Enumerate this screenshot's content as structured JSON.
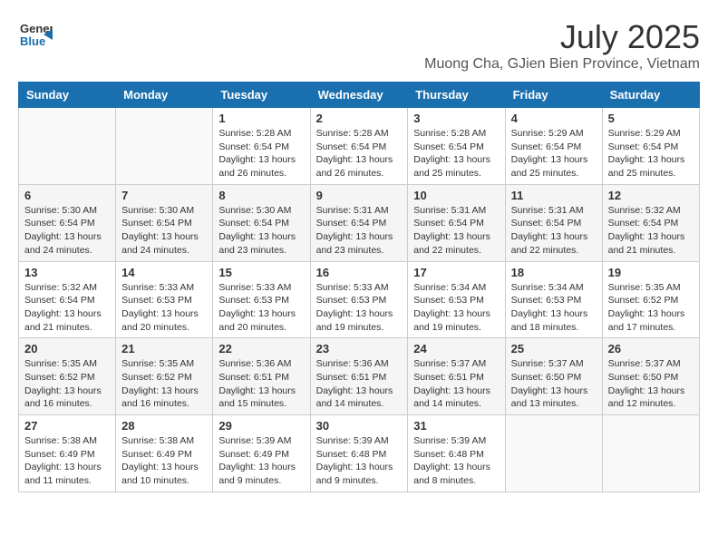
{
  "header": {
    "logo_general": "General",
    "logo_blue": "Blue",
    "month_year": "July 2025",
    "location": "Muong Cha, GJien Bien Province, Vietnam"
  },
  "days_of_week": [
    "Sunday",
    "Monday",
    "Tuesday",
    "Wednesday",
    "Thursday",
    "Friday",
    "Saturday"
  ],
  "weeks": [
    [
      {
        "day": "",
        "info": ""
      },
      {
        "day": "",
        "info": ""
      },
      {
        "day": "1",
        "info": "Sunrise: 5:28 AM\nSunset: 6:54 PM\nDaylight: 13 hours\nand 26 minutes."
      },
      {
        "day": "2",
        "info": "Sunrise: 5:28 AM\nSunset: 6:54 PM\nDaylight: 13 hours\nand 26 minutes."
      },
      {
        "day": "3",
        "info": "Sunrise: 5:28 AM\nSunset: 6:54 PM\nDaylight: 13 hours\nand 25 minutes."
      },
      {
        "day": "4",
        "info": "Sunrise: 5:29 AM\nSunset: 6:54 PM\nDaylight: 13 hours\nand 25 minutes."
      },
      {
        "day": "5",
        "info": "Sunrise: 5:29 AM\nSunset: 6:54 PM\nDaylight: 13 hours\nand 25 minutes."
      }
    ],
    [
      {
        "day": "6",
        "info": "Sunrise: 5:30 AM\nSunset: 6:54 PM\nDaylight: 13 hours\nand 24 minutes."
      },
      {
        "day": "7",
        "info": "Sunrise: 5:30 AM\nSunset: 6:54 PM\nDaylight: 13 hours\nand 24 minutes."
      },
      {
        "day": "8",
        "info": "Sunrise: 5:30 AM\nSunset: 6:54 PM\nDaylight: 13 hours\nand 23 minutes."
      },
      {
        "day": "9",
        "info": "Sunrise: 5:31 AM\nSunset: 6:54 PM\nDaylight: 13 hours\nand 23 minutes."
      },
      {
        "day": "10",
        "info": "Sunrise: 5:31 AM\nSunset: 6:54 PM\nDaylight: 13 hours\nand 22 minutes."
      },
      {
        "day": "11",
        "info": "Sunrise: 5:31 AM\nSunset: 6:54 PM\nDaylight: 13 hours\nand 22 minutes."
      },
      {
        "day": "12",
        "info": "Sunrise: 5:32 AM\nSunset: 6:54 PM\nDaylight: 13 hours\nand 21 minutes."
      }
    ],
    [
      {
        "day": "13",
        "info": "Sunrise: 5:32 AM\nSunset: 6:54 PM\nDaylight: 13 hours\nand 21 minutes."
      },
      {
        "day": "14",
        "info": "Sunrise: 5:33 AM\nSunset: 6:53 PM\nDaylight: 13 hours\nand 20 minutes."
      },
      {
        "day": "15",
        "info": "Sunrise: 5:33 AM\nSunset: 6:53 PM\nDaylight: 13 hours\nand 20 minutes."
      },
      {
        "day": "16",
        "info": "Sunrise: 5:33 AM\nSunset: 6:53 PM\nDaylight: 13 hours\nand 19 minutes."
      },
      {
        "day": "17",
        "info": "Sunrise: 5:34 AM\nSunset: 6:53 PM\nDaylight: 13 hours\nand 19 minutes."
      },
      {
        "day": "18",
        "info": "Sunrise: 5:34 AM\nSunset: 6:53 PM\nDaylight: 13 hours\nand 18 minutes."
      },
      {
        "day": "19",
        "info": "Sunrise: 5:35 AM\nSunset: 6:52 PM\nDaylight: 13 hours\nand 17 minutes."
      }
    ],
    [
      {
        "day": "20",
        "info": "Sunrise: 5:35 AM\nSunset: 6:52 PM\nDaylight: 13 hours\nand 16 minutes."
      },
      {
        "day": "21",
        "info": "Sunrise: 5:35 AM\nSunset: 6:52 PM\nDaylight: 13 hours\nand 16 minutes."
      },
      {
        "day": "22",
        "info": "Sunrise: 5:36 AM\nSunset: 6:51 PM\nDaylight: 13 hours\nand 15 minutes."
      },
      {
        "day": "23",
        "info": "Sunrise: 5:36 AM\nSunset: 6:51 PM\nDaylight: 13 hours\nand 14 minutes."
      },
      {
        "day": "24",
        "info": "Sunrise: 5:37 AM\nSunset: 6:51 PM\nDaylight: 13 hours\nand 14 minutes."
      },
      {
        "day": "25",
        "info": "Sunrise: 5:37 AM\nSunset: 6:50 PM\nDaylight: 13 hours\nand 13 minutes."
      },
      {
        "day": "26",
        "info": "Sunrise: 5:37 AM\nSunset: 6:50 PM\nDaylight: 13 hours\nand 12 minutes."
      }
    ],
    [
      {
        "day": "27",
        "info": "Sunrise: 5:38 AM\nSunset: 6:49 PM\nDaylight: 13 hours\nand 11 minutes."
      },
      {
        "day": "28",
        "info": "Sunrise: 5:38 AM\nSunset: 6:49 PM\nDaylight: 13 hours\nand 10 minutes."
      },
      {
        "day": "29",
        "info": "Sunrise: 5:39 AM\nSunset: 6:49 PM\nDaylight: 13 hours\nand 9 minutes."
      },
      {
        "day": "30",
        "info": "Sunrise: 5:39 AM\nSunset: 6:48 PM\nDaylight: 13 hours\nand 9 minutes."
      },
      {
        "day": "31",
        "info": "Sunrise: 5:39 AM\nSunset: 6:48 PM\nDaylight: 13 hours\nand 8 minutes."
      },
      {
        "day": "",
        "info": ""
      },
      {
        "day": "",
        "info": ""
      }
    ]
  ]
}
